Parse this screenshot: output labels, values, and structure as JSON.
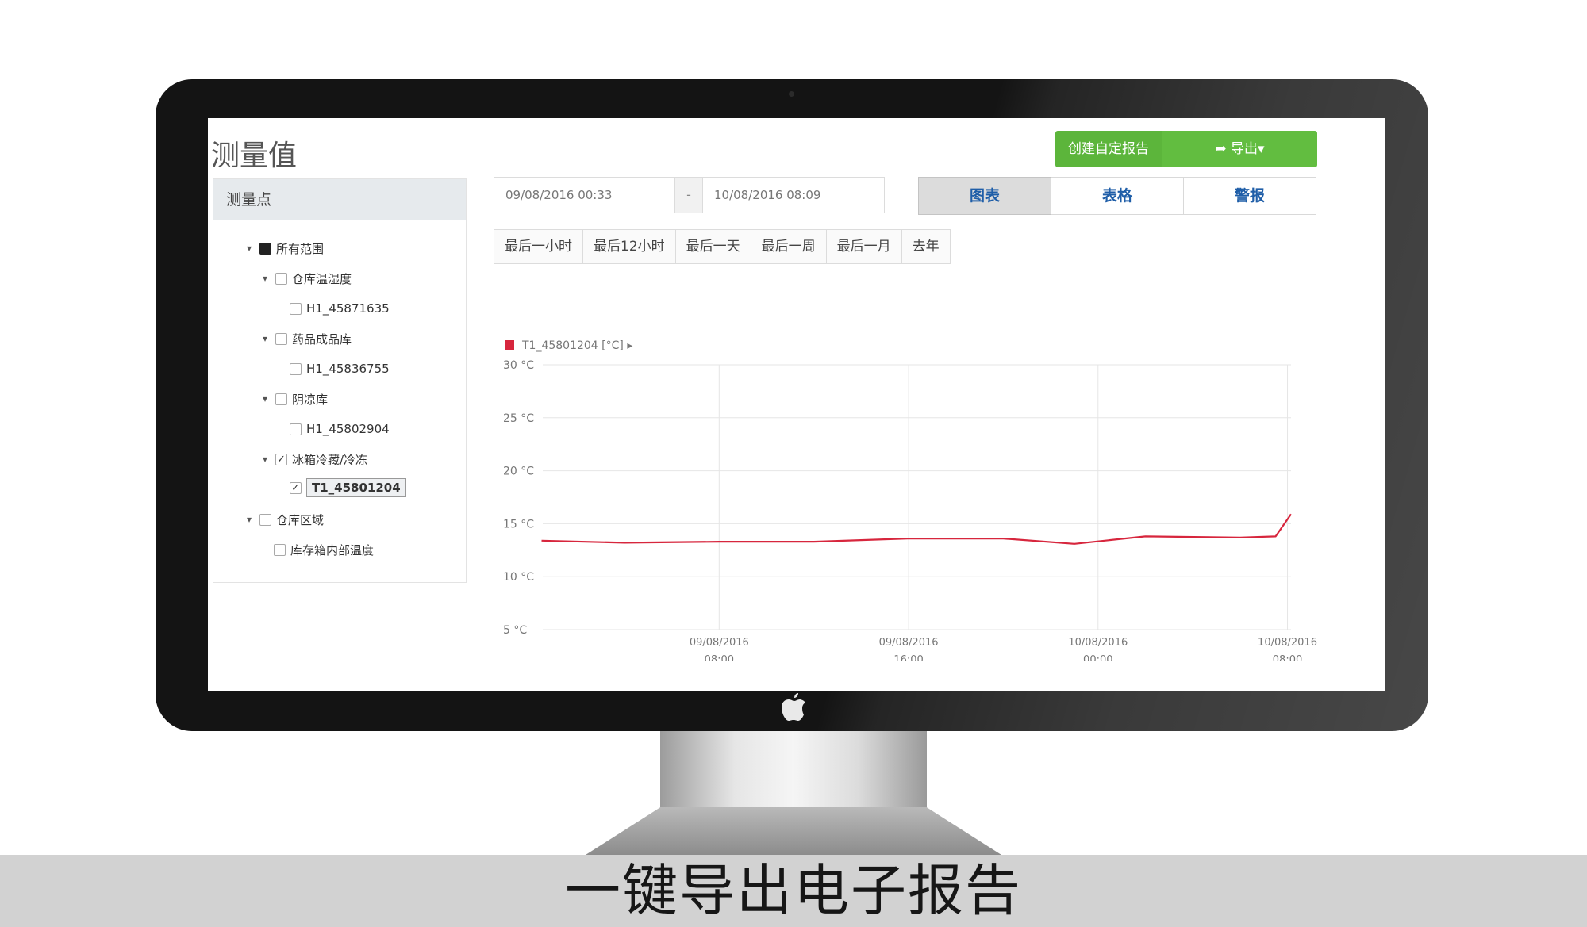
{
  "window": {
    "title": "测量值"
  },
  "toolbar": {
    "create_report_label": "创建自定报告",
    "export_label": "导出▾",
    "export_icon": "share-arrow-icon"
  },
  "sidebar": {
    "header": "测量点",
    "tree": [
      {
        "label": "所有范围",
        "state": "partial",
        "expanded": true
      },
      {
        "label": "仓库温湿度",
        "state": "unchecked",
        "expanded": true
      },
      {
        "label": "H1_45871635",
        "state": "unchecked"
      },
      {
        "label": "药品成品库",
        "state": "unchecked",
        "expanded": true
      },
      {
        "label": "H1_45836755",
        "state": "unchecked"
      },
      {
        "label": "阴凉库",
        "state": "unchecked",
        "expanded": true
      },
      {
        "label": "H1_45802904",
        "state": "unchecked"
      },
      {
        "label": "冰箱冷藏/冷冻",
        "state": "checked",
        "expanded": true
      },
      {
        "label": "T1_45801204",
        "state": "checked",
        "selected": true
      },
      {
        "label": "仓库区域",
        "state": "unchecked",
        "expanded": true
      },
      {
        "label": "库存箱内部温度",
        "state": "unchecked"
      }
    ]
  },
  "date_range": {
    "from": "09/08/2016 00:33",
    "separator": "-",
    "to": "10/08/2016 08:09"
  },
  "view_tabs": [
    {
      "label": "图表",
      "active": true
    },
    {
      "label": "表格",
      "active": false
    },
    {
      "label": "警报",
      "active": false
    }
  ],
  "range_buttons": [
    "最后一小时",
    "最后12小时",
    "最后一天",
    "最后一周",
    "最后一月",
    "去年"
  ],
  "chart_data": {
    "type": "line",
    "series": [
      {
        "name": "T1_45801204 [°C] ▸",
        "color": "#d7263d",
        "x": [
          "09/08/2016 00:30",
          "09/08/2016 04:00",
          "09/08/2016 08:00",
          "09/08/2016 12:00",
          "09/08/2016 16:00",
          "09/08/2016 20:00",
          "09/08/2016 23:00",
          "10/08/2016 02:00",
          "10/08/2016 06:00",
          "10/08/2016 07:30",
          "10/08/2016 08:09"
        ],
        "values": [
          13.4,
          13.2,
          13.3,
          13.3,
          13.6,
          13.6,
          13.1,
          13.8,
          13.7,
          13.8,
          15.9
        ]
      }
    ],
    "y_ticks": [
      "30 °C",
      "25 °C",
      "20 °C",
      "15 °C",
      "10 °C",
      "5 °C"
    ],
    "x_ticks": [
      {
        "date": "09/08/2016",
        "time": "08:00"
      },
      {
        "date": "09/08/2016",
        "time": "16:00"
      },
      {
        "date": "10/08/2016",
        "time": "00:00"
      },
      {
        "date": "10/08/2016",
        "time": "08:00"
      }
    ],
    "x_range": [
      "09/08/2016 00:33",
      "10/08/2016 08:09"
    ],
    "ylim": [
      5,
      30
    ],
    "grid": true,
    "legend": "top-left"
  },
  "caption": "一键导出电子报告"
}
